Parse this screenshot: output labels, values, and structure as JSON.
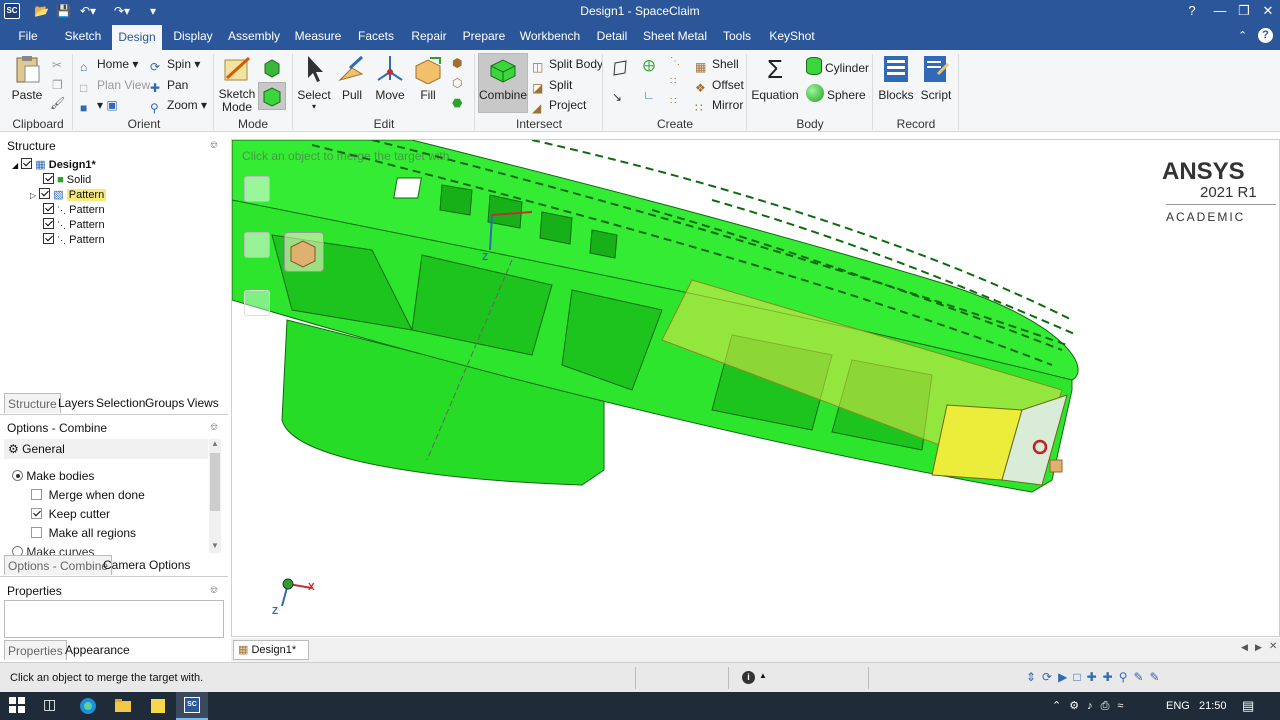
{
  "window": {
    "title": "Design1 - SpaceClaim",
    "app_badge": "SC"
  },
  "menu": {
    "items": [
      "File",
      "Sketch",
      "Design",
      "Display",
      "Assembly",
      "Measure",
      "Facets",
      "Repair",
      "Prepare",
      "Workbench",
      "Detail",
      "Sheet Metal",
      "Tools",
      "KeyShot"
    ],
    "active": "Design"
  },
  "ribbon": {
    "clipboard": {
      "label": "Clipboard",
      "paste": "Paste"
    },
    "orient": {
      "label": "Orient",
      "home": "Home",
      "spin": "Spin",
      "plan_view": "Plan View",
      "pan": "Pan",
      "zoom": "Zoom"
    },
    "mode": {
      "label": "Mode",
      "sketch_mode": "Sketch Mode"
    },
    "edit": {
      "label": "Edit",
      "select": "Select",
      "pull": "Pull",
      "move": "Move",
      "fill": "Fill"
    },
    "intersect": {
      "label": "Intersect",
      "combine": "Combine",
      "split_body": "Split Body",
      "split": "Split",
      "project": "Project"
    },
    "create": {
      "label": "Create",
      "shell": "Shell",
      "offset": "Offset",
      "mirror": "Mirror"
    },
    "body": {
      "label": "Body",
      "equation": "Equation",
      "cylinder": "Cylinder",
      "sphere": "Sphere"
    },
    "record": {
      "label": "Record",
      "blocks": "Blocks",
      "script": "Script"
    }
  },
  "structure": {
    "title": "Structure",
    "root": "Design1*",
    "items": [
      "Solid",
      "Pattern",
      "Pattern",
      "Pattern",
      "Pattern"
    ],
    "tabs": [
      "Structure",
      "Layers",
      "Selection",
      "Groups",
      "Views"
    ]
  },
  "options": {
    "title": "Options - Combine",
    "section": "General",
    "make_bodies": "Make bodies",
    "merge_when_done": "Merge when done",
    "keep_cutter": "Keep cutter",
    "make_all_regions": "Make all regions",
    "make_curves": "Make curves",
    "tabs": [
      "Options - Combine",
      "Camera Options"
    ]
  },
  "properties": {
    "title": "Properties",
    "tabs": [
      "Properties",
      "Appearance"
    ]
  },
  "viewport": {
    "hint": "Click an object to merge the target with.",
    "watermark_brand": "ANSYS",
    "watermark_version": "2021 R1",
    "watermark_edition": "ACADEMIC",
    "axis_z": "Z",
    "axis_x": "X",
    "body_color": "#2ee52e",
    "highlight_color": "#e8e84a"
  },
  "doc_tab": {
    "label": "Design1*"
  },
  "status": {
    "message": "Click an object to merge the target with."
  },
  "taskbar": {
    "lang": "ENG",
    "time": "21:50"
  }
}
